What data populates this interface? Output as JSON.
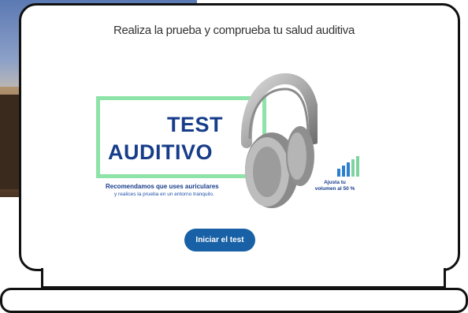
{
  "heading": "Realiza la prueba y comprueba tu salud auditiva",
  "banner": {
    "title_line1": "TEST",
    "title_line2": "AUDITIVO",
    "recommendation_line1": "Recomendamos que uses auriculares",
    "recommendation_line2": "y realices la prueba en un entorno tranquilo.",
    "volume_hint_line1": "Ajusta tu",
    "volume_hint_line2": "volumen al 50 %"
  },
  "start_button": "Iniciar el test",
  "colors": {
    "title": "#173d8a",
    "frame_green": "#8ee3a8",
    "button": "#1961a6",
    "volume_bars": "#2e7fd0"
  },
  "icons": {
    "headphones": "headphones-icon",
    "volume": "volume-bars-icon"
  }
}
